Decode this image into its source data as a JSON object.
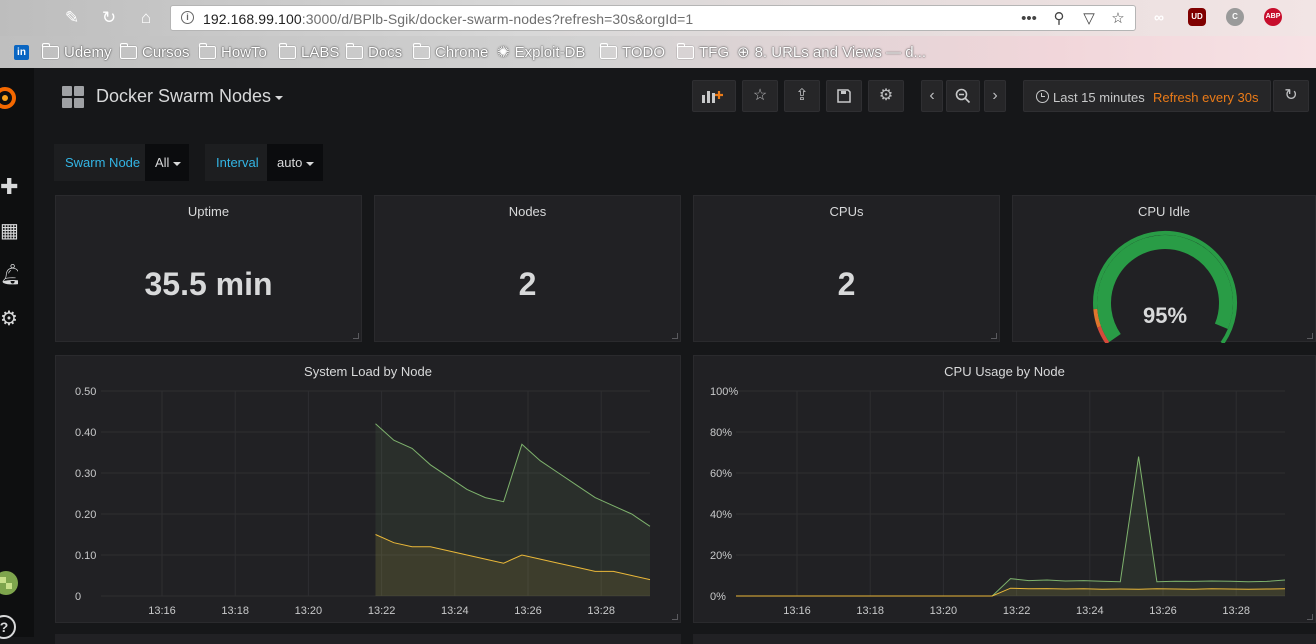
{
  "browser": {
    "url_host": "192.168.99.100",
    "url_rest": ":3000/d/BPlb-Sgik/docker-swarm-nodes?refresh=30s&orgId=1",
    "bookmarks": [
      {
        "label": "Udemy",
        "icon": "folder-icon"
      },
      {
        "label": "Cursos",
        "icon": "folder-icon"
      },
      {
        "label": "HowTo",
        "icon": "folder-icon"
      },
      {
        "label": "LABS",
        "icon": "folder-icon"
      },
      {
        "label": "Docs",
        "icon": "folder-icon"
      },
      {
        "label": "Chrome",
        "icon": "folder-icon"
      },
      {
        "label": "Exploit-DB",
        "icon": "exploit-db-icon"
      },
      {
        "label": "TODO",
        "icon": "folder-icon"
      },
      {
        "label": "TFG",
        "icon": "folder-icon"
      },
      {
        "label": "8. URLs and Views — d...",
        "icon": "globe-icon"
      }
    ],
    "extensions": {
      "ublock": "UD",
      "abp": "ABP"
    }
  },
  "dashboard": {
    "title": "Docker Swarm Nodes",
    "time_range": "Last 15 minutes",
    "refresh": "Refresh every 30s"
  },
  "variables": [
    {
      "label": "Swarm Node",
      "value": "All"
    },
    {
      "label": "Interval",
      "value": "auto"
    }
  ],
  "stats": {
    "uptime": {
      "title": "Uptime",
      "value": "35.5 min"
    },
    "nodes": {
      "title": "Nodes",
      "value": "2"
    },
    "cpus": {
      "title": "CPUs",
      "value": "2"
    },
    "cpu_idle": {
      "title": "CPU Idle",
      "value": "95%",
      "fraction": 0.95
    }
  },
  "colors": {
    "accent_orange": "#eb7b18",
    "var_label_blue": "#33b5e5",
    "series_green": "#7eb26d",
    "series_yellow": "#eab839",
    "gauge_green": "#299c46"
  },
  "chart_data": [
    {
      "type": "area",
      "title": "System Load by Node",
      "xlabel": "",
      "ylabel": "",
      "x_ticks": [
        "13:16",
        "13:18",
        "13:20",
        "13:22",
        "13:24",
        "13:26",
        "13:28"
      ],
      "y_ticks": [
        "0",
        "0.10",
        "0.20",
        "0.30",
        "0.40",
        "0.50"
      ],
      "xlim": [
        "13:14:20",
        "13:29:20"
      ],
      "ylim": [
        0,
        0.5
      ],
      "grid": true,
      "series": [
        {
          "x": [
            "13:21:50",
            "13:22:20",
            "13:22:50",
            "13:23:20",
            "13:23:50",
            "13:24:20",
            "13:24:50",
            "13:25:20",
            "13:25:50",
            "13:26:20",
            "13:26:50",
            "13:27:20",
            "13:27:50",
            "13:28:20",
            "13:28:50",
            "13:29:20"
          ],
          "values": [
            0.42,
            0.38,
            0.36,
            0.32,
            0.29,
            0.26,
            0.24,
            0.23,
            0.37,
            0.33,
            0.3,
            0.27,
            0.24,
            0.22,
            0.2,
            0.17
          ],
          "color": "#7eb26d"
        },
        {
          "x": [
            "13:21:50",
            "13:22:20",
            "13:22:50",
            "13:23:20",
            "13:23:50",
            "13:24:20",
            "13:24:50",
            "13:25:20",
            "13:25:50",
            "13:26:20",
            "13:26:50",
            "13:27:20",
            "13:27:50",
            "13:28:20",
            "13:28:50",
            "13:29:20"
          ],
          "values": [
            0.15,
            0.13,
            0.12,
            0.12,
            0.11,
            0.1,
            0.09,
            0.08,
            0.1,
            0.09,
            0.08,
            0.07,
            0.06,
            0.06,
            0.05,
            0.04
          ],
          "color": "#eab839"
        }
      ]
    },
    {
      "type": "area",
      "title": "CPU Usage by Node",
      "xlabel": "",
      "ylabel": "",
      "x_ticks": [
        "13:16",
        "13:18",
        "13:20",
        "13:22",
        "13:24",
        "13:26",
        "13:28"
      ],
      "y_ticks": [
        "0%",
        "20%",
        "40%",
        "60%",
        "80%",
        "100%"
      ],
      "xlim": [
        "13:14:20",
        "13:29:20"
      ],
      "ylim": [
        0,
        100
      ],
      "grid": true,
      "series": [
        {
          "x": [
            "13:14:20",
            "13:21:20",
            "13:21:50",
            "13:22:20",
            "13:22:50",
            "13:23:20",
            "13:23:50",
            "13:24:20",
            "13:24:50",
            "13:25:20",
            "13:25:50",
            "13:26:20",
            "13:26:50",
            "13:27:20",
            "13:27:50",
            "13:28:20",
            "13:28:50",
            "13:29:20"
          ],
          "values": [
            0,
            0,
            8.5,
            7.5,
            7.8,
            7.3,
            7.5,
            7.2,
            7.0,
            68,
            7.0,
            7.2,
            7.1,
            7.3,
            7.2,
            7.0,
            7.1,
            7.8
          ],
          "color": "#7eb26d"
        },
        {
          "x": [
            "13:14:20",
            "13:21:20",
            "13:21:50",
            "13:22:20",
            "13:22:50",
            "13:23:20",
            "13:23:50",
            "13:24:20",
            "13:24:50",
            "13:25:20",
            "13:25:50",
            "13:26:20",
            "13:26:50",
            "13:27:20",
            "13:27:50",
            "13:28:20",
            "13:28:50",
            "13:29:20"
          ],
          "values": [
            0,
            0,
            3.8,
            3.5,
            3.6,
            3.4,
            3.5,
            3.3,
            3.4,
            3.3,
            3.5,
            3.4,
            3.3,
            3.5,
            3.4,
            3.3,
            3.4,
            3.5
          ],
          "color": "#eab839"
        }
      ]
    }
  ]
}
